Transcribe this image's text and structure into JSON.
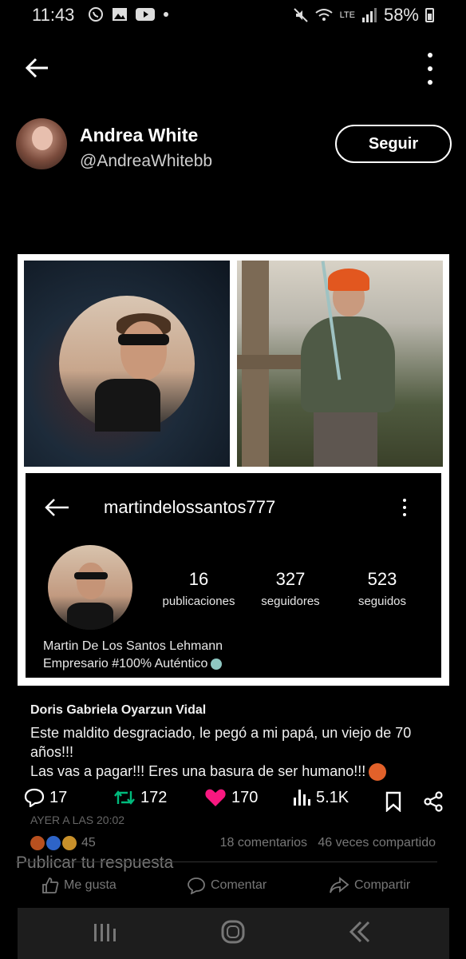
{
  "status_bar": {
    "time": "11:43",
    "battery": "58%",
    "network": "LTE"
  },
  "post": {
    "display_name": "Andrea White",
    "handle": "@AndreaWhitebb",
    "follow_label": "Seguir"
  },
  "instagram": {
    "username": "martindelossantos777",
    "stats": [
      {
        "value": "16",
        "label": "publicaciones"
      },
      {
        "value": "327",
        "label": "seguidores"
      },
      {
        "value": "523",
        "label": "seguidos"
      }
    ],
    "bio_name": "Martin De Los Santos Lehmann",
    "bio_line": "Empresario #100% Auténtico"
  },
  "facebook_comment": {
    "author": "Doris Gabriela Oyarzun Vidal",
    "lines": [
      "Este maldito desgraciado, le pegó a mi papá, un viejo de 70 años!!!",
      "Las vas a pagar!!! Eres una basura de ser humano!!!"
    ],
    "timestamp": "AYER A LAS 20:02",
    "reaction_count": "45",
    "comments_count": "18 comentarios",
    "shares_count": "46 veces compartido",
    "buttons": {
      "like": "Me gusta",
      "comment": "Comentar",
      "share": "Compartir"
    }
  },
  "actions": {
    "replies": "17",
    "reposts": "172",
    "likes": "170",
    "views": "5.1K"
  },
  "reply_placeholder": "Publicar tu respuesta",
  "colors": {
    "repost": "#00ba7c",
    "like": "#f91880",
    "background": "#000000"
  }
}
